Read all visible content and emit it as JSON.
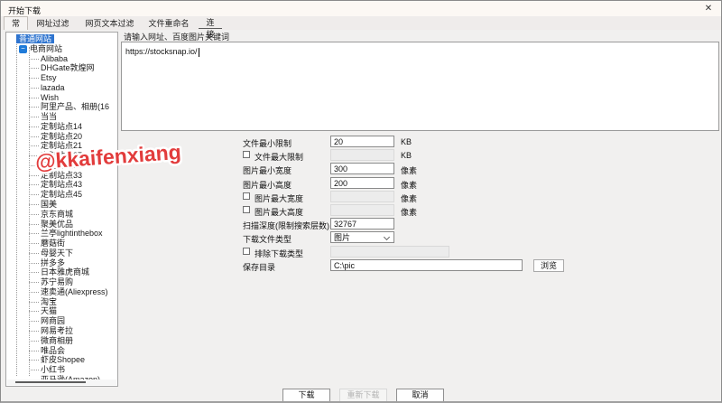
{
  "window": {
    "title": "开始下载",
    "close_icon": "✕"
  },
  "tabs": [
    {
      "label": "常用"
    },
    {
      "label": "网址过滤"
    },
    {
      "label": "网页文本过滤"
    },
    {
      "label": "文件重命名"
    },
    {
      "label": "连接"
    }
  ],
  "tree": {
    "root_item": "普通网站",
    "group_item": "电商网站",
    "group_icon": "−",
    "items": [
      "Alibaba",
      "DHGate敦煌网",
      "Etsy",
      "lazada",
      "Wish",
      "阿里产品、相册(16",
      "当当",
      "定制站点14",
      "定制站点20",
      "定制站点21",
      "定制站点27",
      "定制站点32",
      "定制站点33",
      "定制站点43",
      "定制站点45",
      "国美",
      "京东商城",
      "聚美优品",
      "兰亭lightinthebox",
      "蘑菇街",
      "母婴天下",
      "拼多多",
      "日本雅虎商城",
      "苏宁易购",
      "速卖通(Aliexpress)",
      "淘宝",
      "天猫",
      "网商园",
      "网易考拉",
      "微商相册",
      "唯品会",
      "虾皮Shopee",
      "小红书",
      "亚马逊(Amazon)"
    ]
  },
  "url_panel": {
    "label": "请输入网址、百度图片关键词",
    "value": "https://stocksnap.io/"
  },
  "form": {
    "rows": [
      {
        "label": "文件最小限制",
        "value": "20",
        "unit": "KB"
      },
      {
        "label": "文件最大限制",
        "checkbox": true,
        "value": "",
        "unit": "KB",
        "disabled": true
      },
      {
        "label": "图片最小宽度",
        "value": "300",
        "unit": "像素"
      },
      {
        "label": "图片最小高度",
        "value": "200",
        "unit": "像素"
      },
      {
        "label": "图片最大宽度",
        "checkbox": true,
        "value": "",
        "unit": "像素",
        "disabled": true
      },
      {
        "label": "图片最大高度",
        "checkbox": true,
        "value": "",
        "unit": "像素",
        "disabled": true
      },
      {
        "label": "扫描深度(限制搜索层数)",
        "value": "32767"
      },
      {
        "label": "下载文件类型",
        "value": "图片",
        "control": "select"
      },
      {
        "label": "排除下载类型",
        "checkbox": true,
        "value": "",
        "disabled": true
      },
      {
        "label": "保存目录",
        "value": "C:\\pic",
        "button": "浏览"
      }
    ]
  },
  "footer": {
    "download": "下载",
    "redownload": "重新下载",
    "cancel": "取消"
  },
  "watermark": {
    "text": "@kkaifenxiang",
    "color": "#e23c3c"
  },
  "colors": {
    "selection_blue": "#2e74cf",
    "node_blue": "#1f7bd9",
    "watermark_red": "#e23c3c"
  }
}
